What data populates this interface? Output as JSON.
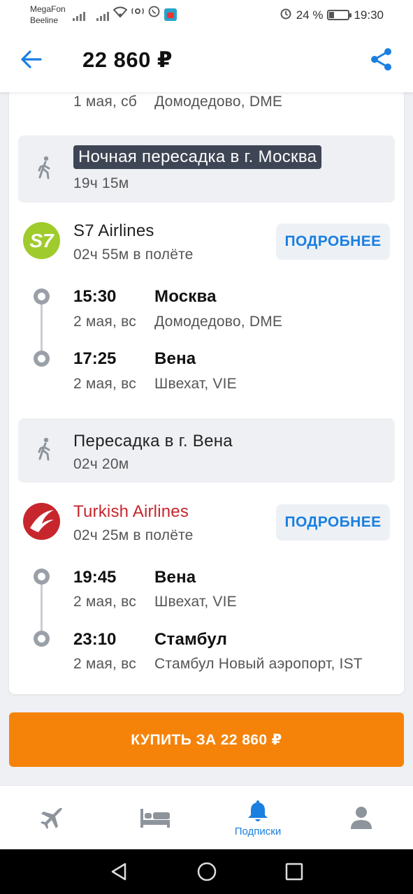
{
  "status_bar": {
    "carrier1": "MegaFon",
    "carrier2": "Beeline",
    "battery_text": "24 %",
    "battery_level": 0.24,
    "time": "19:30"
  },
  "header": {
    "price": "22 860 ₽",
    "back_icon": "arrow-left-icon",
    "share_icon": "share-icon",
    "accent": "#1b7fe0"
  },
  "segment0": {
    "date": "1 мая, сб",
    "airport": "Домодедово, DME"
  },
  "layovers": [
    {
      "title": "Ночная пересадка в г. Москва",
      "duration": "19ч 15м",
      "highlight": true
    },
    {
      "title": "Пересадка в г. Вена",
      "duration": "02ч 20м",
      "highlight": false
    }
  ],
  "flights": [
    {
      "airline": "S7 Airlines",
      "logo_text": "S7",
      "logo_color": "#9fcb2c",
      "flight_time": "02ч 55м в полёте",
      "details_label": "ПОДРОБНЕЕ",
      "dep": {
        "time": "15:30",
        "date": "2 мая, вс",
        "city": "Москва",
        "airport": "Домодедово, DME"
      },
      "arr": {
        "time": "17:25",
        "date": "2 мая, вс",
        "city": "Вена",
        "airport": "Швехат, VIE"
      }
    },
    {
      "airline": "Turkish Airlines",
      "logo_color": "#c8262d",
      "flight_time": "02ч 25м в полёте",
      "details_label": "ПОДРОБНЕЕ",
      "dep": {
        "time": "19:45",
        "date": "2 мая, вс",
        "city": "Вена",
        "airport": "Швехат, VIE"
      },
      "arr": {
        "time": "23:10",
        "date": "2 мая, вс",
        "city": "Стамбул",
        "airport": "Стамбул Новый аэропорт, IST"
      }
    }
  ],
  "buy_button": {
    "label": "КУПИТЬ ЗА 22 860 ₽",
    "color": "#f5830a"
  },
  "bottom_nav": {
    "items": [
      {
        "icon": "plane-icon",
        "label": ""
      },
      {
        "icon": "hotel-bed-icon",
        "label": ""
      },
      {
        "icon": "bell-icon",
        "label": "Подписки",
        "active": true
      },
      {
        "icon": "profile-icon",
        "label": ""
      }
    ]
  }
}
